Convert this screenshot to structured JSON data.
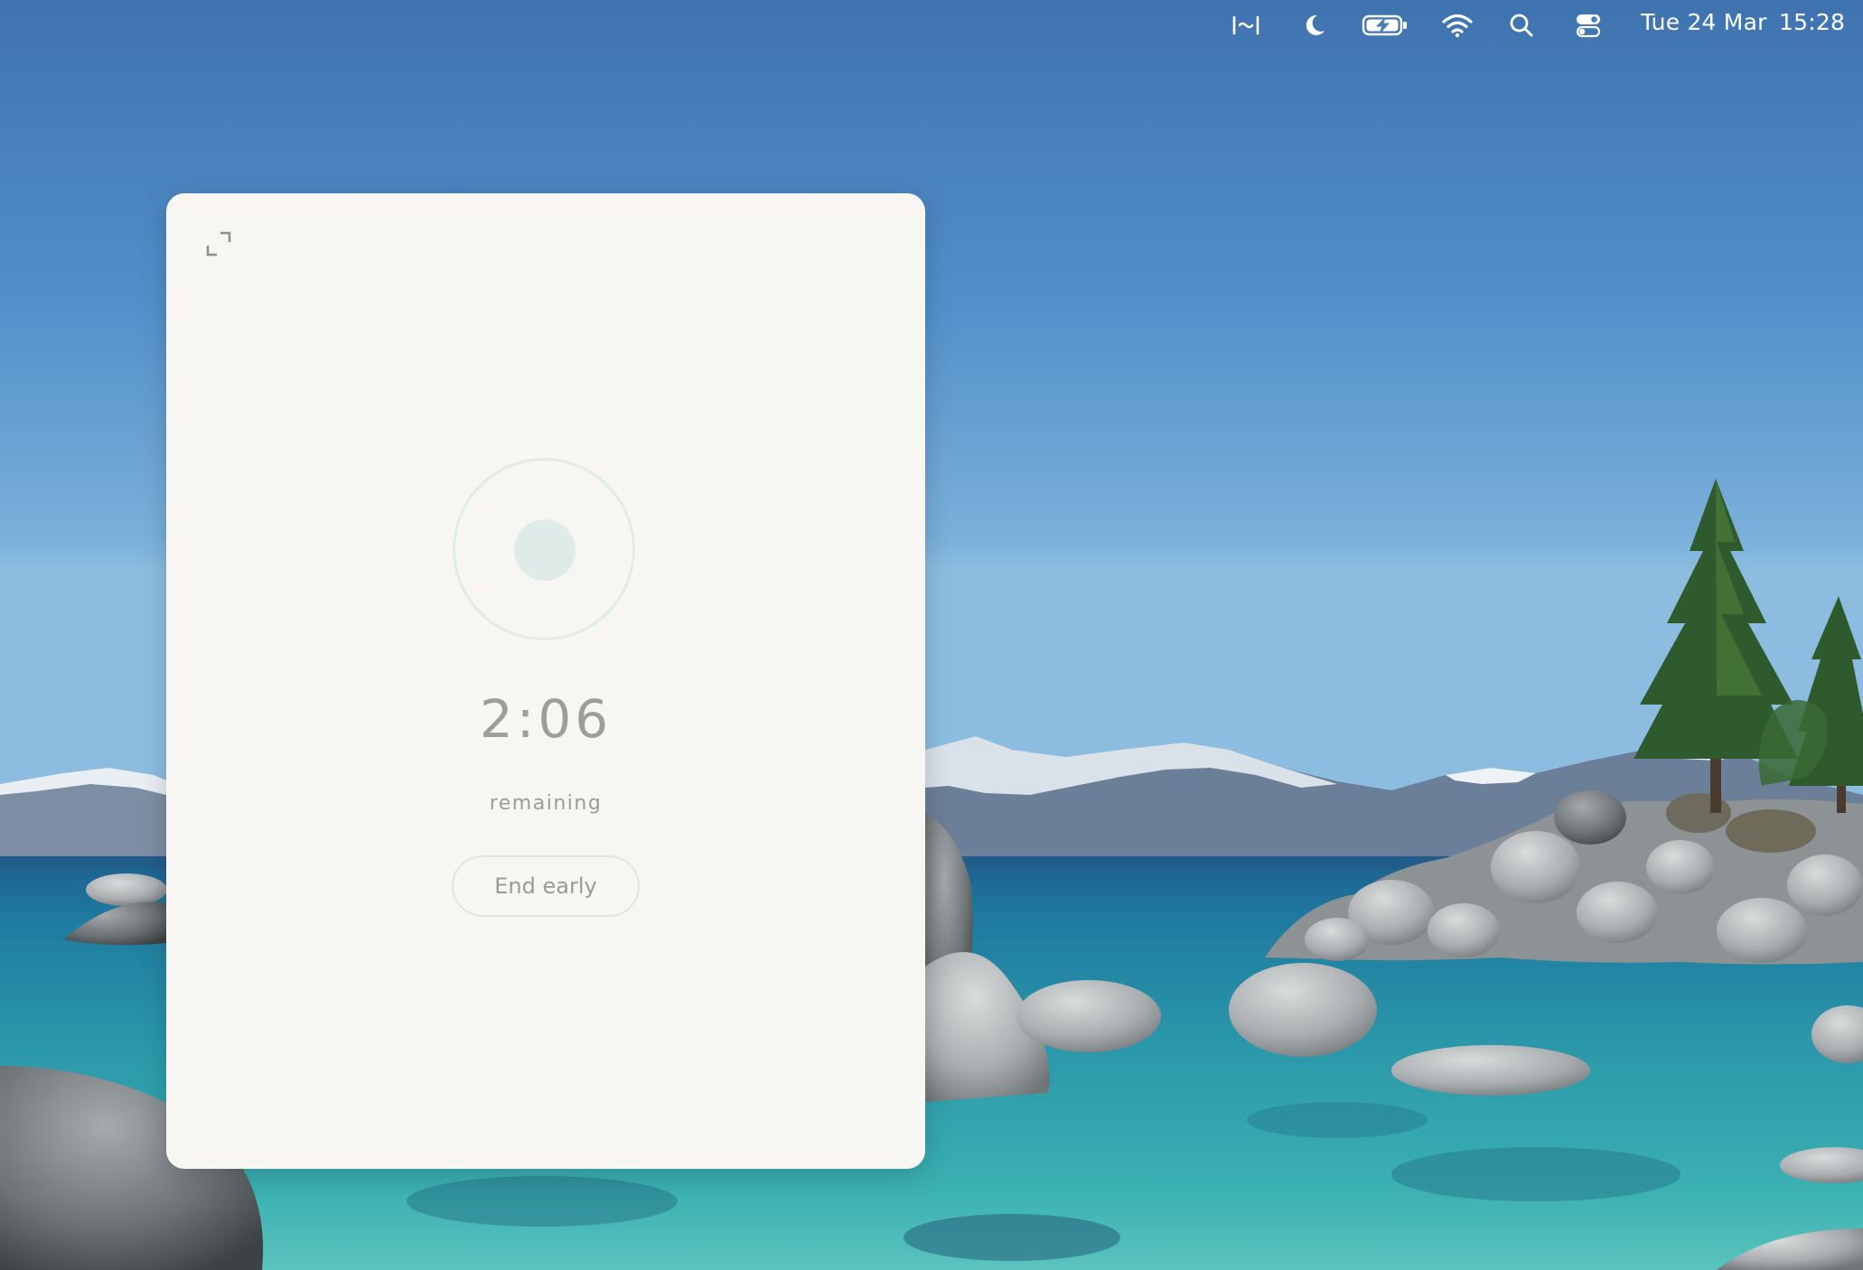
{
  "menubar": {
    "icons": [
      "terminal-icon",
      "moon-icon",
      "battery-charging-icon",
      "wifi-icon",
      "search-icon",
      "control-center-icon"
    ],
    "date": "Tue 24 Mar",
    "time": "15:28"
  },
  "panel": {
    "expand_icon": "expand-icon",
    "timer": {
      "value": "2:06",
      "label": "remaining"
    },
    "end_button_label": "End early"
  },
  "colors": {
    "panel_bg": "#f7f6f2",
    "ring": "#e1ebe8",
    "dot": "#dfebe8",
    "muted_text": "#9d9d9a"
  }
}
